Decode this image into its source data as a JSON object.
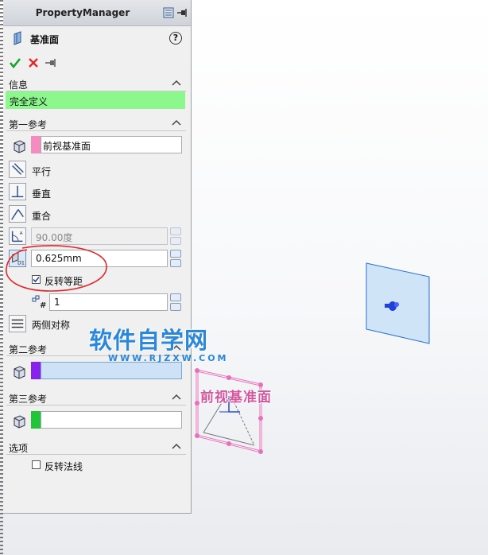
{
  "panel": {
    "title": "PropertyManager",
    "feature_title": "基准面",
    "help_label": "?"
  },
  "sections": {
    "info": {
      "title": "信息",
      "status": "完全定义",
      "status_color": "#8cf78c"
    },
    "first_reference": {
      "title": "第一参考",
      "selection": "前视基准面",
      "swatch_color": "#f48cc0",
      "options": {
        "parallel": "平行",
        "perpendicular": "垂直",
        "coincident": "重合"
      },
      "angle_value": "90.00度",
      "offset_value": "0.625mm",
      "flip_offset_label": "反转等距",
      "flip_offset_checked": true,
      "instances_value": "1",
      "mid_plane_label": "两侧对称"
    },
    "second_reference": {
      "title": "第二参考",
      "swatch_color": "#8a22ee"
    },
    "third_reference": {
      "title": "第三参考",
      "swatch_color": "#22c43a"
    },
    "options": {
      "title": "选项",
      "flip_normal_label": "反转法线",
      "flip_normal_checked": false
    }
  },
  "viewport": {
    "plane_label": "前视基准面",
    "watermark_main": "软件自学网",
    "watermark_sub": "WWW.RJZXW.COM"
  },
  "colors": {
    "accent_red": "#e3262a",
    "confirm_green": "#1aa32a",
    "plane_pink": "#e870b8",
    "plane_blue": "#2a6fd6"
  }
}
